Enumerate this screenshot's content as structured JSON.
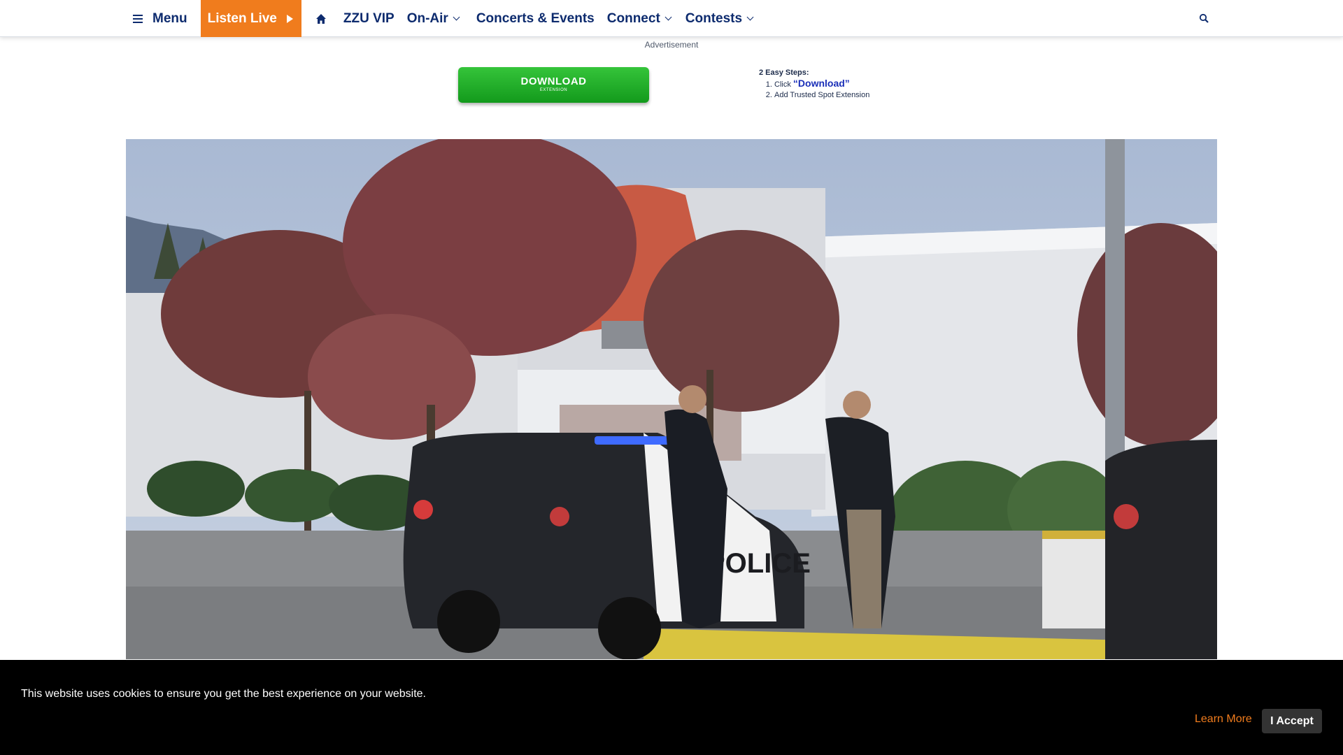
{
  "nav": {
    "menu_label": "Menu",
    "listen_live_label": "Listen Live",
    "links": [
      {
        "label": "ZZU VIP",
        "dropdown": false
      },
      {
        "label": "On-Air",
        "dropdown": true
      },
      {
        "label": "Concerts & Events",
        "dropdown": false
      },
      {
        "label": "Connect",
        "dropdown": true
      },
      {
        "label": "Contests",
        "dropdown": true
      }
    ],
    "icons": [
      "hamburger-icon",
      "play-icon",
      "home-icon",
      "chevron-down-icon",
      "search-icon"
    ],
    "colors": {
      "text": "#0d2b6e",
      "listen_live_bg": "#f07c1d"
    }
  },
  "ad": {
    "label": "Advertisement",
    "download_label": "DOWNLOAD",
    "download_sublabel": "EXTENSION",
    "steps_title": "2 Easy Steps:",
    "step1_prefix": "Click",
    "step1_link": "“Download”",
    "step2": "Add Trusted Spot Extension",
    "colors": {
      "button": "#1fae27"
    }
  },
  "hero": {
    "description_of_image": "",
    "car_text": "POLICE"
  },
  "cookie_banner": {
    "message": "This website uses cookies to ensure you get the best experience on your website.",
    "learn_more_label": "Learn More",
    "accept_label": "I Accept",
    "colors": {
      "background": "#000000",
      "learn_more": "#f07c1d",
      "accept_bg": "#333333"
    }
  }
}
